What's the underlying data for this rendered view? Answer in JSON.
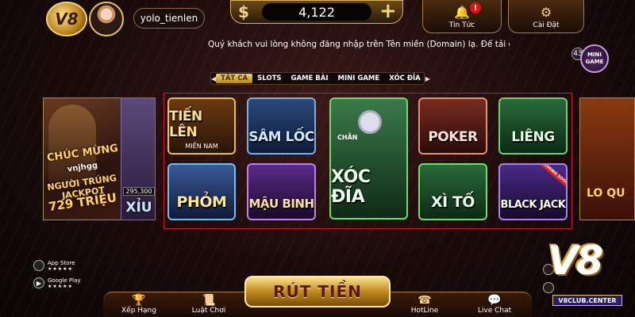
{
  "header": {
    "logo_text": "V8",
    "username": "yolo_tienlen",
    "currency_icon": "dollar-icon",
    "balance": "4,122",
    "plus": "+",
    "news_label": "Tin Tức",
    "news_badge": "!",
    "settings_label": "Cài Đặt"
  },
  "marquee_text": "Quý khách vui lòng không đăng nhập trên Tên miền (Domain) lạ. Để tải gá",
  "mini_game": {
    "label": "MINI GAME",
    "count": "43"
  },
  "tabs": [
    "TẤT CẢ",
    "SLOTS",
    "GAME BÀI",
    "MINI GAME",
    "XÓC ĐĨA"
  ],
  "jackpot": {
    "line1": "CHÚC MỪNG",
    "line2": "vnjhgg",
    "line3": "NGƯỜI TRÚNG JACKPOT",
    "line4": "729 TRIỆU"
  },
  "taixiu": {
    "number": "295,300",
    "label": "XỈU"
  },
  "games": [
    {
      "name": "TIẾN LÊN",
      "sub": "MIỀN NAM"
    },
    {
      "name": "SÂM LỐC"
    },
    {
      "name": "XÓC ĐĨA",
      "tag": "CHẴN"
    },
    {
      "name": "POKER"
    },
    {
      "name": "LIÊNG"
    },
    {
      "name": "PHỎM"
    },
    {
      "name": "MẬU BINH"
    },
    {
      "name": "XÌ TỐ"
    },
    {
      "name": "BLACK JACK",
      "ribbon": "COMING SOON"
    }
  ],
  "side_game": {
    "label": "LO QU"
  },
  "stores": {
    "appstore": "App Store",
    "googleplay": "Google Play",
    "stars": "★★★★★"
  },
  "bottom": {
    "xephang": "Xếp Hạng",
    "luatchoi": "Luật Chơi",
    "rut_tien": "RÚT TIỀN",
    "hotline": "HotLine",
    "livechat": "Live Chat"
  },
  "watermark": {
    "logo": "V8",
    "url": "V8CLUB.CENTER"
  },
  "colors": {
    "accent_gold": "#f3d38a",
    "highlight_frame": "#c8182a"
  }
}
